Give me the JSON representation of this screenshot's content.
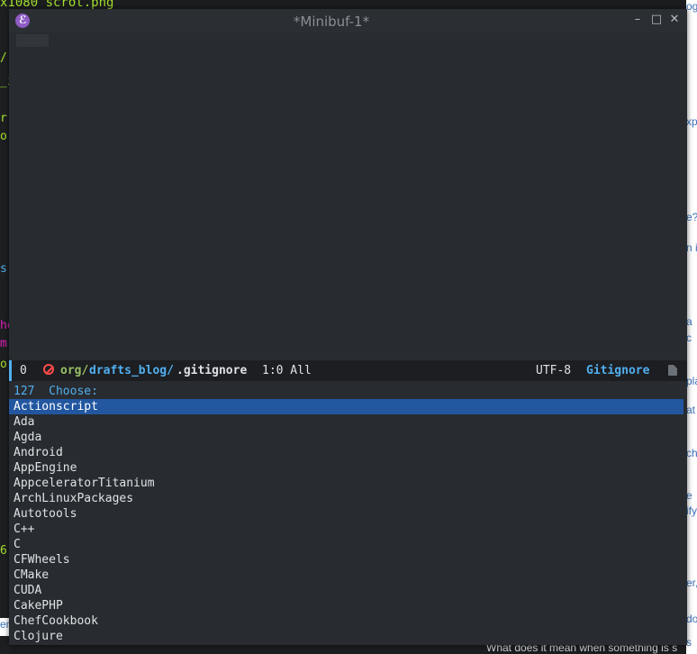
{
  "background": {
    "terminal_top_text": "x1080 scrot.png",
    "terminal_fragments": [
      {
        "text": "/",
        "color": "#a6e22e"
      },
      {
        "text": "_i",
        "color": "#a6e22e"
      },
      {
        "text": "r",
        "color": "#a6e22e"
      },
      {
        "text": "o",
        "color": "#a6e22e"
      },
      {
        "text": "s",
        "color": "#51afef"
      },
      {
        "text": "he",
        "color": "#e11cbb"
      },
      {
        "text": "m",
        "color": "#e11cbb"
      },
      {
        "text": "o",
        "color": "#a6e22e"
      },
      {
        "text": "6:",
        "color": "#a6e22e"
      }
    ],
    "web_fragments": [
      "og in",
      "xp",
      "e?",
      "n i",
      "a",
      "c",
      "pla",
      "at",
      "ch",
      "e",
      "ify",
      "er,",
      "do",
      "s"
    ],
    "bottom_strip_text": "What does it mean when something is s"
  },
  "window": {
    "title": "*Minibuf-1*",
    "app_icon": "emacs-icon",
    "buttons": {
      "minimize": "minimize-icon",
      "maximize": "maximize-icon",
      "close": "close-icon"
    },
    "minimize_glyph": "–",
    "maximize_glyph": "□",
    "close_glyph": "✕"
  },
  "mode_line": {
    "number": "0",
    "status_icon": "no-entry-icon",
    "path_dir": "org/",
    "path_sub": "drafts_blog/",
    "path_file": ".gitignore",
    "position": "1:0 All",
    "encoding": "UTF-8",
    "major_mode": "Gitignore",
    "file_icon": "document-icon"
  },
  "minibuffer": {
    "count": "127",
    "prompt": "Choose:",
    "selected_index": 0,
    "candidates": [
      "Actionscript",
      "Ada",
      "Agda",
      "Android",
      "AppEngine",
      "AppceleratorTitanium",
      "ArchLinuxPackages",
      "Autotools",
      "C++",
      "C",
      "CFWheels",
      "CMake",
      "CUDA",
      "CakePHP",
      "ChefCookbook",
      "Clojure"
    ]
  },
  "colors": {
    "accent_blue": "#51afef",
    "selection": "#2257a0",
    "path_green": "#98be65",
    "error_red": "#ff4a4a",
    "emacs_purple": "#8e5bc4"
  }
}
